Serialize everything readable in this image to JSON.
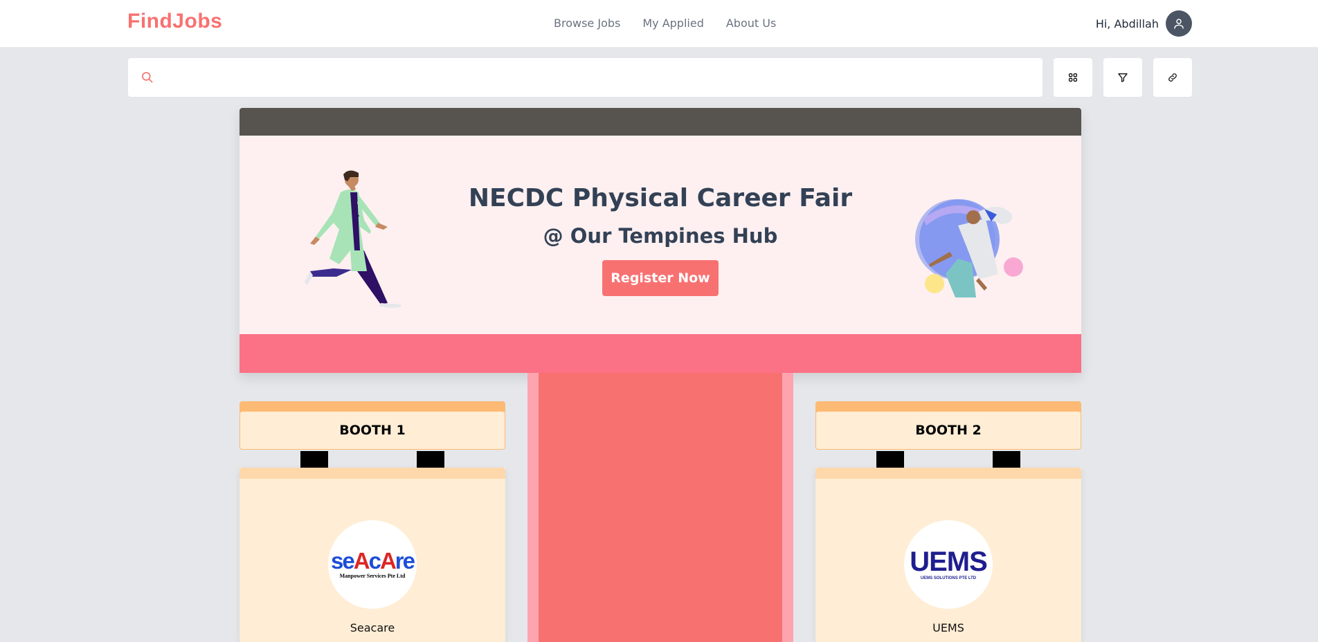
{
  "header": {
    "logo": "FindJobs",
    "nav": [
      "Browse Jobs",
      "My Applied",
      "About Us"
    ],
    "greeting": "Hi, Abdillah"
  },
  "search": {
    "placeholder": "",
    "value": ""
  },
  "toolbar": {
    "icons": [
      "grid-icon",
      "filter-icon",
      "link-icon"
    ]
  },
  "banner": {
    "title": "NECDC Physical Career Fair",
    "subtitle": "@ Our Tempines Hub",
    "button": "Register Now"
  },
  "booths": [
    {
      "label": "BOOTH 1",
      "company": "Seacare",
      "logo_main": "seAcAre",
      "logo_sub": "Manpower Services Pte Ltd"
    },
    {
      "label": "BOOTH 2",
      "company": "UEMS",
      "logo_main": "UEMS",
      "logo_sub": "UEMS SOLUTIONS PTE LTD"
    }
  ],
  "colors": {
    "brand": "#f87171",
    "roof": "#57534e",
    "banner_foot": "#fb7185",
    "booth": "#ffedd5"
  }
}
